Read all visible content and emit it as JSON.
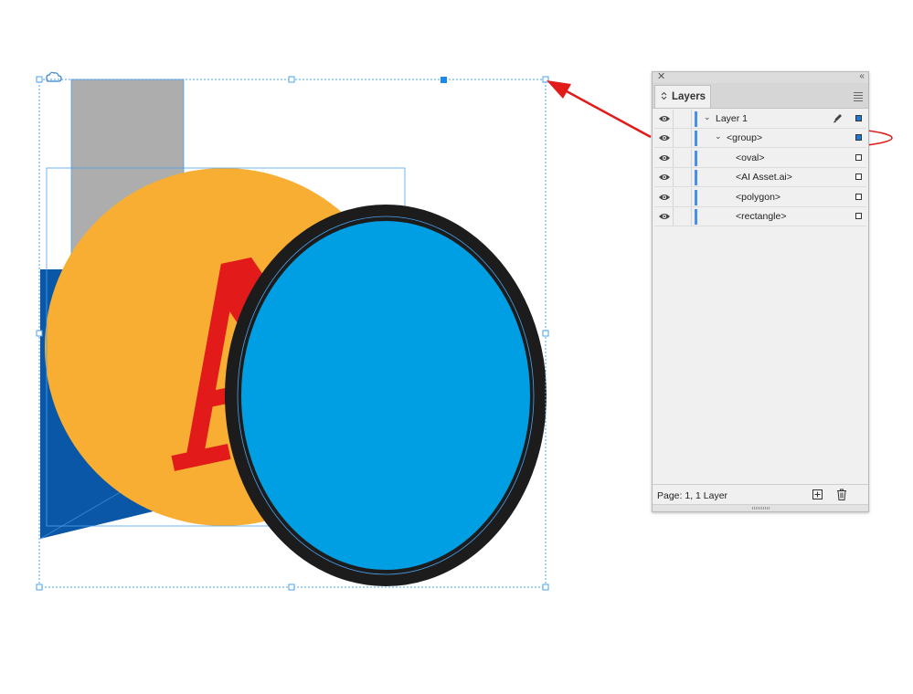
{
  "colors": {
    "gray_rect": "#adadad",
    "yellow_circle": "#f8ae32",
    "red_glyph": "#e21a1a",
    "blue_polygon": "#0a57a8",
    "blue_ellipse": "#009fe3",
    "ellipse_stroke": "#1c1c1c",
    "selection_blue": "#1e88e5",
    "annotation_red": "#e21a1a"
  },
  "canvas": {
    "asset_glyph": "A",
    "cloud_icon": "cloud-icon"
  },
  "panel": {
    "close_glyph": "✕",
    "collapse_glyph": "‹‹",
    "tab_arrows": "⌃⌄",
    "tab_label": "Layers",
    "rows": [
      {
        "name": "Layer 1",
        "expanded": true,
        "selected": true
      },
      {
        "name": "<group>",
        "expanded": true,
        "selected": true
      },
      {
        "name": "<oval>",
        "selected": false
      },
      {
        "name": "<AI Asset.ai>",
        "selected": false
      },
      {
        "name": "<polygon>",
        "selected": false
      },
      {
        "name": "<rectangle>",
        "selected": false
      }
    ],
    "chevron_glyph": "⌄",
    "footer_text": "Page: 1, 1 Layer",
    "icons": [
      "eye-icon",
      "chevron-down-icon",
      "pen-icon",
      "new-layer-icon",
      "trash-icon",
      "panel-menu-icon"
    ]
  }
}
